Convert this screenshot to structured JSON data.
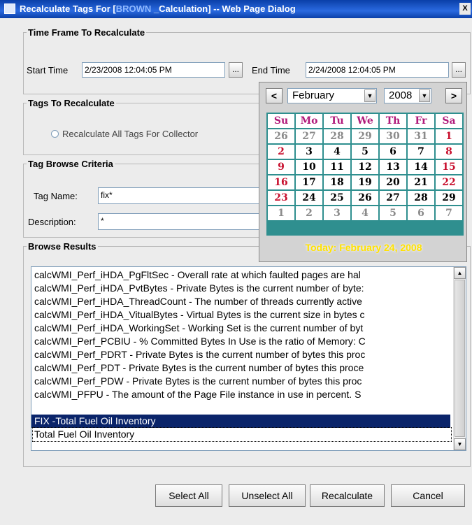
{
  "title": {
    "prefix": "Recalculate Tags For [",
    "brand": "BROWN",
    "suffix": " _Calculation] -- Web Page Dialog",
    "close": "X"
  },
  "time_frame": {
    "legend": "Time Frame To Recalculate",
    "start_label": "Start Time",
    "start_value": "2/23/2008 12:04:05 PM",
    "end_label": "End Time",
    "end_value": "2/24/2008 12:04:05 PM",
    "picker_label": "..."
  },
  "tags": {
    "legend": "Tags To Recalculate",
    "radio_label": "Recalculate All Tags For Collector"
  },
  "criteria": {
    "legend": "Tag Browse Criteria",
    "name_label": "Tag Name:",
    "name_value": "fix*",
    "desc_label": "Description:",
    "desc_value": "*"
  },
  "calendar": {
    "prev": "<",
    "next": ">",
    "month": "February",
    "year": "2008",
    "weekdays": [
      "Su",
      "Mo",
      "Tu",
      "We",
      "Th",
      "Fr",
      "Sa"
    ],
    "weeks": [
      [
        "26",
        "27",
        "28",
        "29",
        "30",
        "31",
        "1"
      ],
      [
        "2",
        "3",
        "4",
        "5",
        "6",
        "7",
        "8"
      ],
      [
        "9",
        "10",
        "11",
        "12",
        "13",
        "14",
        "15"
      ],
      [
        "16",
        "17",
        "18",
        "19",
        "20",
        "21",
        "22"
      ],
      [
        "23",
        "24",
        "25",
        "26",
        "27",
        "28",
        "29"
      ],
      [
        "1",
        "2",
        "3",
        "4",
        "5",
        "6",
        "7"
      ]
    ],
    "today": "Today: February 24, 2008"
  },
  "results": {
    "legend": "Browse Results",
    "items": [
      "calcWMI_Perf_iHDA_PgFltSec - Overall rate at which faulted pages are hal",
      "calcWMI_Perf_iHDA_PvtBytes - Private Bytes is the current number of byte:",
      "calcWMI_Perf_iHDA_ThreadCount - The number of threads currently active",
      "calcWMI_Perf_iHDA_VitualBytes - Virtual Bytes is the current size in bytes c",
      "calcWMI_Perf_iHDA_WorkingSet - Working Set is the current number of byt",
      "calcWMI_Perf_PCBIU - % Committed Bytes In Use is the ratio of Memory: C",
      "calcWMI_Perf_PDRT - Private Bytes is the current number of bytes this proc",
      "calcWMI_Perf_PDT - Private Bytes is the current number of bytes this proce",
      "calcWMI_Perf_PDW - Private Bytes is the current number of bytes this proc",
      "calcWMI_PFPU - The amount of the Page File instance in use in percent. S",
      "FIX -Total Fuel Oil Inventory",
      "Total Fuel Oil Inventory"
    ]
  },
  "buttons": {
    "select_all": "Select All",
    "unselect_all": "Unselect All",
    "recalculate": "Recalculate",
    "cancel": "Cancel"
  }
}
